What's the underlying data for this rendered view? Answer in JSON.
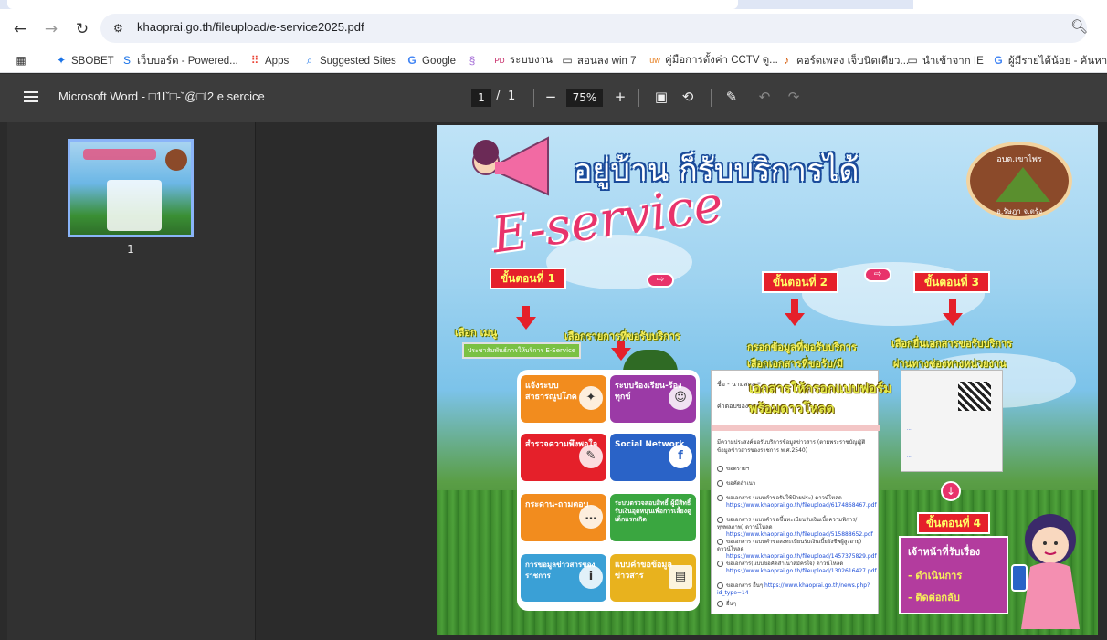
{
  "browser": {
    "url": "khaoprai.go.th/fileupload/e-service2025.pdf",
    "bookmarks": [
      {
        "label": "SBOBET",
        "icon": "sbobet-icon"
      },
      {
        "label": "เว็บบอร์ด - Powered...",
        "icon": "webboard-icon"
      },
      {
        "label": "Apps",
        "icon": "apps-grid-icon"
      },
      {
        "label": "Suggested Sites",
        "icon": "search-icon"
      },
      {
        "label": "Google",
        "icon": "google-icon"
      },
      {
        "label": "ระบบงาน",
        "icon": "pdp-icon"
      },
      {
        "label": "สอนลง win 7",
        "icon": "folder-icon"
      },
      {
        "label": "คู่มือการตั้งค่า CCTV ดู...",
        "icon": "cctv-icon"
      },
      {
        "label": "คอร์ดเพลง เจ็บนิดเดียว...",
        "icon": "guitar-icon"
      },
      {
        "label": "นำเข้าจาก IE",
        "icon": "folder-icon"
      },
      {
        "label": "ผู้มีรายได้น้อย - ค้นหาด้...",
        "icon": "google-icon"
      }
    ]
  },
  "pdf": {
    "title": "Microsoft Word - □1Iˇ□-ˇ@□I2 e sercice",
    "page_current": "1",
    "page_sep": "/",
    "page_total": "1",
    "zoom": "75%",
    "thumb_label": "1"
  },
  "poster": {
    "headline": "อยู่บ้าน ก็รับบริการได้",
    "eservice": "E-service",
    "seal_top": "อบต.เขาไพร",
    "seal_bottom": "อ.รัษฎา จ.ตรัง",
    "step1": "ขั้นตอนที่ 1",
    "step2": "ขั้นตอนที่ 2",
    "step3": "ขั้นตอนที่ 3",
    "step4": "ขั้นตอนที่ 4",
    "choose_menu": "เลือก เมนู",
    "choose_item": "เลือกรายการที่ขอรับบริการ",
    "menu_button": "ประชาสัมพันธ์การให้บริการ E-Service",
    "fill_line1": "กรอกข้อมูลที่ขอรับบริการ",
    "fill_line2": "เลือกเอกสารที่ขอรับ/มี",
    "step3_line1": "เลือกยื่นเอกสารขอรับบริการ",
    "step3_line2": "ผ่านทางช่องทางหน่วยงาน",
    "form_overlay_1": "เอกสารให้กรอกแบบฟอร์ม",
    "form_overlay_2": "พร้อมดาวโหลด",
    "tiles": [
      {
        "label": "แจ้งระบบสาธารณูปโภค",
        "color": "#f28c1e",
        "icon": "wrench-icon"
      },
      {
        "label": "ระบบร้องเรียน-ร้องทุกข์",
        "color": "#9b3aa6",
        "icon": "person-icon"
      },
      {
        "label": "สำรวจความพึงพอใจ",
        "color": "#e5202a",
        "icon": "clipboard-icon"
      },
      {
        "label": "Social Network",
        "color": "#2a63c7",
        "icon": "facebook-icon"
      },
      {
        "label": "กระดาน-ถามตอบ",
        "color": "#f28c1e",
        "icon": "chat-icon"
      },
      {
        "label": "ระบบตรวจสอบสิทธิ์ ผู้มีสิทธิ์รับเงินอุดหนุนเพื่อการเลี้ยงดูเด็กแรกเกิด",
        "color": "#3aa640",
        "icon": "checklist-icon"
      },
      {
        "label": "การขอมูลข่าวสารของราชการ",
        "color": "#3aa0d6",
        "icon": "info-icon"
      },
      {
        "label": "แบบคำขอข้อมูลข่าวสาร",
        "color": "#e8b21e",
        "icon": "news-icon"
      }
    ],
    "form": {
      "field1": "ชื่อ - นามสกุล *",
      "field2": "คำตอบของคุณ",
      "desc": "มีความประสงค์ขอรับบริการข้อมูลข่าวสาร (ตามพระราชบัญญัติข้อมูลข่าวสารของราชการ พ.ศ.2540)",
      "options": [
        {
          "text": "ขอดรายฯ",
          "link": ""
        },
        {
          "text": "ขอคัดสำเนา",
          "link": ""
        },
        {
          "text": "ขอเอกสาร (แบบคำขอรับใช้ป้ายประ) ดาวน์โหลด",
          "link": "https://www.khaoprai.go.th/fileupload/6174868467.pdf"
        },
        {
          "text": "ขอเอกสาร (แบบคำขอขึ้นทะเบียนรับเงินเบี้ยความพิการ/ทุพพลภาพ) ดาวน์โหลด",
          "link": "https://www.khaoprai.go.th/fileupload/515888652.pdf"
        },
        {
          "text": "ขอเอกสาร (แบบคำขอลงทะเบียนรับเงินเบี้ยยังชีพผู้สูงอายุ) ดาวน์โหลด",
          "link": "https://www.khaoprai.go.th/fileupload/1457375829.pdf"
        },
        {
          "text": "ขอเอกสาร(แบบขอคัดสำเนาสมัครใจ) ดาวน์โหลด",
          "link": "https://www.khaoprai.go.th/fileupload/1302616427.pdf"
        },
        {
          "text": "ขอเอกสาร อื่นๆ",
          "link": "https://www.khaoprai.go.th/news.php?id_type=14"
        },
        {
          "text": "อื่นๆ",
          "link": ""
        }
      ]
    },
    "pink_title": "เจ้าหน้าที่รับเรื่อง",
    "pink_item1": "-  ดำเนินการ",
    "pink_item2": "-  ติดต่อกลับ"
  }
}
